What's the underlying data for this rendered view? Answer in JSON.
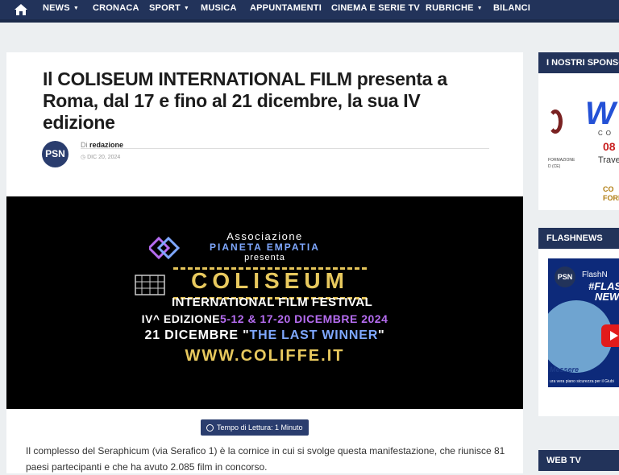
{
  "nav": {
    "items": [
      {
        "label": "NEWS",
        "dropdown": true
      },
      {
        "label": "CRONACA",
        "dropdown": false
      },
      {
        "label": "SPORT",
        "dropdown": true
      },
      {
        "label": "MUSICA",
        "dropdown": false
      },
      {
        "label": "APPUNTAMENTI",
        "dropdown": false
      },
      {
        "label": "CINEMA E SERIE TV",
        "dropdown": false
      },
      {
        "label": "RUBRICHE",
        "dropdown": true
      },
      {
        "label": "BILANCI",
        "dropdown": false
      }
    ]
  },
  "article": {
    "title": "Il COLISEUM INTERNATIONAL FILM presenta a Roma, dal 17 e fino al 21 dicembre, la sua IV edizione",
    "avatar_text": "PSN",
    "by_prefix": "Di",
    "author": "redazione",
    "date": "DIC 20, 2024",
    "reading_time": "Tempo di Lettura: 1 Minuto",
    "body": "Il complesso del Seraphicum (via Serafico 1) è la cornice in cui si svolge questa manifestazione, che riunisce 81 paesi partecipanti e che ha avuto 2.085 film in concorso."
  },
  "hero": {
    "association": "Associazione",
    "org": "PIANETA EMPATIA",
    "presenta": "presenta",
    "coliseum": "COLISEUM",
    "festival": "INTERNATIONAL FILM FESTIVAL",
    "edition_label": "IV^ EDIZIONE",
    "edition_dates": "5-12 & 17-20 DICEMBRE 2024",
    "date_21": "21 DICEMBRE \"",
    "winner": "THE LAST WINNER",
    "close_quote": "\"",
    "url": "WWW.COLIFFE.IT"
  },
  "sidebar": {
    "sponsors_title": "I NOSTRI SPONSOR",
    "sponsor": {
      "c_text": "CO",
      "phone_fragment": "08",
      "trav": "Trave",
      "small_text": "FORMAZIONE\nD (CE)",
      "co_line1": "CO",
      "co_line2": "FORM"
    },
    "flashnews_title": "FLASHNEWS",
    "flashnews_video": {
      "avatar": "PSN",
      "channel": "FlashN",
      "hashtag": "#FLAS",
      "news": "NEW",
      "messere": "Messere",
      "caption": "ura vera piano sicurezza per il Giubi"
    },
    "webtv_title": "WEB TV"
  },
  "colors": {
    "nav_bg": "#22335a",
    "accent": "#2a3d6e",
    "gold": "#e8c95e",
    "purple": "#b56cf0",
    "blue": "#7fa8ff"
  }
}
